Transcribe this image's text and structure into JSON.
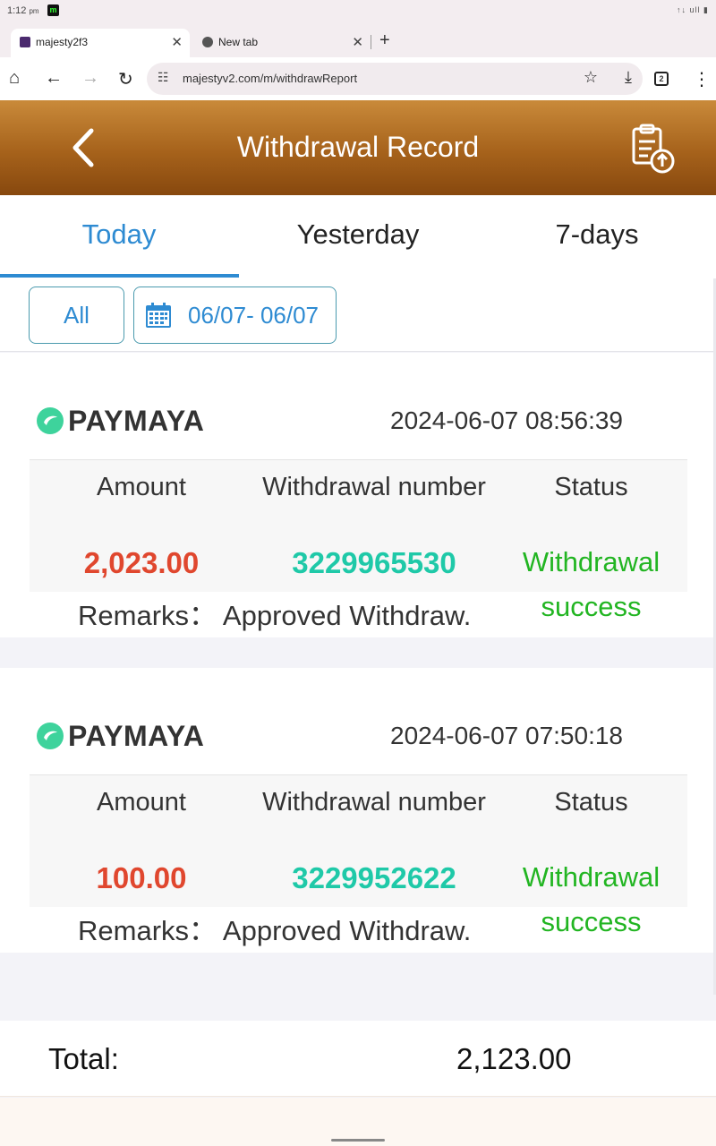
{
  "status_bar": {
    "time": "1:12",
    "ampm": "pm",
    "badge": "m",
    "sys": "↑↓ ull ▮"
  },
  "browser": {
    "tabs": [
      {
        "title": "majesty2f3",
        "close": "✕"
      },
      {
        "title": "New tab",
        "close": "✕"
      }
    ],
    "new_tab": "+",
    "url": "majestyv2.com/m/withdrawReport",
    "tab_count": "2",
    "icons": {
      "home": "⌂",
      "back": "←",
      "forward": "→",
      "reload": "↻",
      "tune": "☷",
      "star": "☆",
      "download": "⤓",
      "menu": "⋮"
    }
  },
  "header": {
    "title": "Withdrawal Record"
  },
  "date_tabs": [
    "Today",
    "Yesterday",
    "7-days"
  ],
  "filters": {
    "all": "All",
    "range": "06/07- 06/07"
  },
  "records": [
    {
      "method": "PAYMAYA",
      "timestamp": "2024-06-07 08:56:39",
      "labels": {
        "amount": "Amount",
        "number": "Withdrawal number",
        "status": "Status"
      },
      "amount": "2,023.00",
      "number": "3229965530",
      "status_line1": "Withdrawal",
      "status_line2": "success",
      "remarks": "Remarks： Approved Withdraw."
    },
    {
      "method": "PAYMAYA",
      "timestamp": "2024-06-07 07:50:18",
      "labels": {
        "amount": "Amount",
        "number": "Withdrawal number",
        "status": "Status"
      },
      "amount": "100.00",
      "number": "3229952622",
      "status_line1": "Withdrawal",
      "status_line2": "success",
      "remarks": "Remarks： Approved Withdraw."
    }
  ],
  "total": {
    "label": "Total:",
    "value": "2,123.00"
  },
  "colors": {
    "accent": "#2e8bd2",
    "amount": "#e0472e",
    "number": "#1fc9a8",
    "success": "#22b522",
    "header": "#a6621b"
  }
}
